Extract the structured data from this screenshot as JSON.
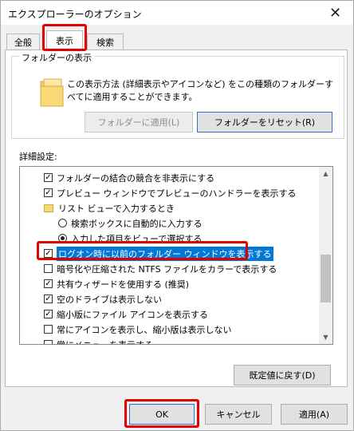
{
  "window": {
    "title": "エクスプローラーのオプション",
    "close_glyph": "✕"
  },
  "tabs": [
    {
      "label": "全般"
    },
    {
      "label": "表示",
      "active": true
    },
    {
      "label": "検索"
    }
  ],
  "folder_view": {
    "group_label": "フォルダーの表示",
    "description": "この表示方法 (詳細表示やアイコンなど) をこの種類のフォルダーすべてに適用することができます。",
    "apply_button": "フォルダーに適用(L)",
    "reset_button": "フォルダーをリセット(R)"
  },
  "advanced": {
    "label": "詳細設定:",
    "items": [
      {
        "type": "checkbox",
        "checked": true,
        "label": "フォルダーの結合の競合を非表示にする"
      },
      {
        "type": "checkbox",
        "checked": true,
        "label": "プレビュー ウィンドウでプレビューのハンドラーを表示する"
      },
      {
        "type": "folder",
        "label": "リスト ビューで入力するとき"
      },
      {
        "type": "radio",
        "checked": false,
        "label": "検索ボックスに自動的に入力する"
      },
      {
        "type": "radio",
        "checked": true,
        "label": "入力した項目をビューで選択する"
      },
      {
        "type": "checkbox",
        "checked": true,
        "selected": true,
        "label": "ログオン時に以前のフォルダー ウィンドウを表示する"
      },
      {
        "type": "checkbox",
        "checked": false,
        "label": "暗号化や圧縮された NTFS ファイルをカラーで表示する"
      },
      {
        "type": "checkbox",
        "checked": true,
        "label": "共有ウィザードを使用する (推奨)"
      },
      {
        "type": "checkbox",
        "checked": true,
        "label": "空のドライブは表示しない"
      },
      {
        "type": "checkbox",
        "checked": true,
        "label": "縮小版にファイル アイコンを表示する"
      },
      {
        "type": "checkbox",
        "checked": false,
        "label": "常にアイコンを表示し、縮小版は表示しない"
      },
      {
        "type": "checkbox",
        "checked": false,
        "label": "常にメニューを表示する"
      }
    ],
    "restore_button": "既定値に戻す(D)"
  },
  "footer": {
    "ok": "OK",
    "cancel": "キャンセル",
    "apply": "適用(A)"
  }
}
